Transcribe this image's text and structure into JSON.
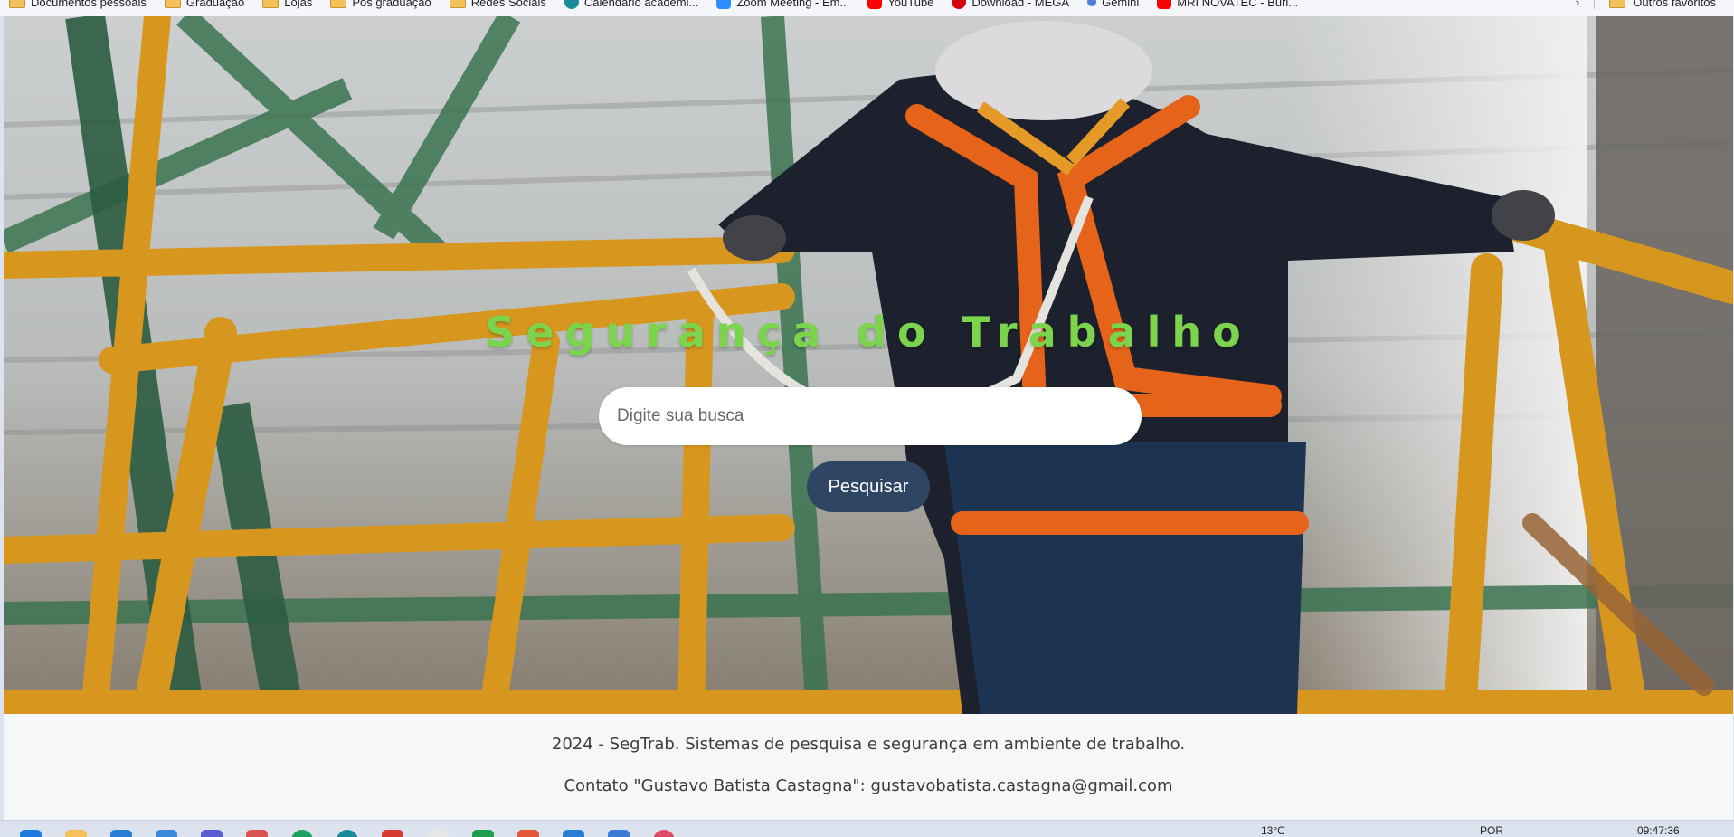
{
  "bookmarks": {
    "items": [
      {
        "label": "Documentos pessoais",
        "icon": "folder-icon"
      },
      {
        "label": "Graduação",
        "icon": "folder-icon"
      },
      {
        "label": "Lojas",
        "icon": "folder-icon"
      },
      {
        "label": "Pós graduação",
        "icon": "folder-icon"
      },
      {
        "label": "Redes Sociais",
        "icon": "folder-icon"
      },
      {
        "label": "Calendário acadêmi...",
        "icon": "calendar-icon"
      },
      {
        "label": "Zoom Meeting - Em...",
        "icon": "zoom-icon"
      },
      {
        "label": "YouTube",
        "icon": "youtube-icon"
      },
      {
        "label": "Download - MEGA",
        "icon": "mega-icon"
      },
      {
        "label": "Gemini",
        "icon": "gemini-icon"
      },
      {
        "label": "MRI NOVATEC - Buri...",
        "icon": "youtube-icon"
      }
    ],
    "other_favorites": "Outros favoritos"
  },
  "hero": {
    "title": "Segurança do Trabalho",
    "search_placeholder": "Digite sua busca",
    "search_button": "Pesquisar"
  },
  "footer": {
    "line1": "2024 - SegTrab. Sistemas de pesquisa e segurança em ambiente de trabalho.",
    "line2": "Contato \"Gustavo Batista Castagna\": gustavobatista.castagna@gmail.com"
  },
  "taskbar": {
    "weather": "13°C",
    "language": "POR",
    "time": "09:47:36"
  },
  "colors": {
    "title_green": "#7cd44c",
    "button_navy": "#2e4664",
    "rail_yellow": "#e3a020",
    "harness_orange": "#f26a1b"
  }
}
